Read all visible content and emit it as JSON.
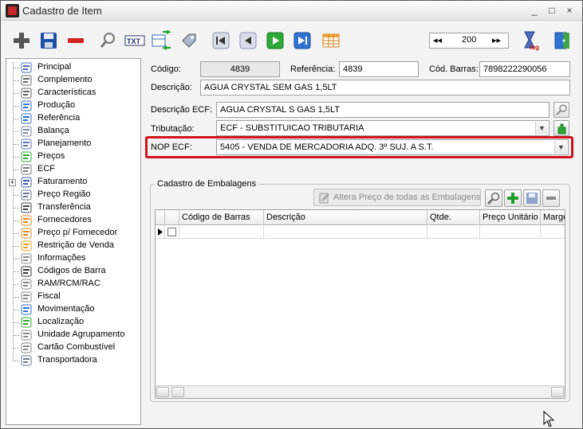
{
  "window": {
    "title": "Cadastro de Item",
    "controls": [
      "_",
      "□",
      "×"
    ]
  },
  "navigator": {
    "first": "◂◂",
    "value": "200",
    "last": "▸▸"
  },
  "tree": {
    "items": [
      {
        "label": "Principal",
        "icon": "list-icon"
      },
      {
        "label": "Complemento",
        "icon": "paperclip-icon"
      },
      {
        "label": "Características",
        "icon": "paperclip-icon"
      },
      {
        "label": "Produção",
        "icon": "production-icon"
      },
      {
        "label": "Referência",
        "icon": "reference-icon"
      },
      {
        "label": "Balança",
        "icon": "scale-icon"
      },
      {
        "label": "Planejamento",
        "icon": "planning-icon"
      },
      {
        "label": "Preços",
        "icon": "money-icon"
      },
      {
        "label": "ECF",
        "icon": "printer-icon"
      },
      {
        "label": "Faturamento",
        "icon": "invoice-icon",
        "expandable": true
      },
      {
        "label": "Preço Região",
        "icon": "truck-icon"
      },
      {
        "label": "Transferência",
        "icon": "transfer-icon"
      },
      {
        "label": "Fornecedores",
        "icon": "people-icon"
      },
      {
        "label": "Preço p/ Fornecedor",
        "icon": "person-money-icon"
      },
      {
        "label": "Restrição de Venda",
        "icon": "person-block-icon"
      },
      {
        "label": "Informações",
        "icon": "document-icon"
      },
      {
        "label": "Códigos de Barra",
        "icon": "barcode-icon"
      },
      {
        "label": "RAM/RCM/RAC",
        "icon": "document-icon"
      },
      {
        "label": "Fiscal",
        "icon": "calculator-icon"
      },
      {
        "label": "Movimentação",
        "icon": "movement-icon"
      },
      {
        "label": "Localização",
        "icon": "location-icon"
      },
      {
        "label": "Unidade Agrupamento",
        "icon": "document-icon"
      },
      {
        "label": "Cartão Combustível",
        "icon": "document-icon"
      },
      {
        "label": "Transportadora",
        "icon": "truck-icon"
      }
    ]
  },
  "form": {
    "codigo_label": "Código:",
    "codigo_value": "4839",
    "referencia_label": "Referência:",
    "referencia_value": "4839",
    "cod_barras_label": "Cód. Barras:",
    "cod_barras_value": "7898222290056",
    "descricao_label": "Descrição:",
    "descricao_value": "AGUA CRYSTAL SEM GAS 1,5LT",
    "descricao_ecf_label": "Descrição ECF:",
    "descricao_ecf_value": "AGUA CRYSTAL S GAS 1,5LT",
    "tributacao_label": "Tributação:",
    "tributacao_value": "ECF - SUBSTITUICAO TRIBUTARIA",
    "nop_label": "NOP ECF:",
    "nop_value": "5405 - VENDA DE MERCADORIA ADQ. 3º SUJ. A S.T."
  },
  "embalagens": {
    "title": "Cadastro de Embalagens",
    "alter_button": "Altera Preço de todas as Embalagens",
    "columns": [
      "Código de Barras",
      "Descrição",
      "Qtde.",
      "Preço Unitário",
      "Marge"
    ]
  },
  "colors": {
    "highlight": "#d0121a",
    "accent_green": "#1e9e2a",
    "accent_red": "#d32020",
    "accent_blue": "#1f5fbf"
  }
}
